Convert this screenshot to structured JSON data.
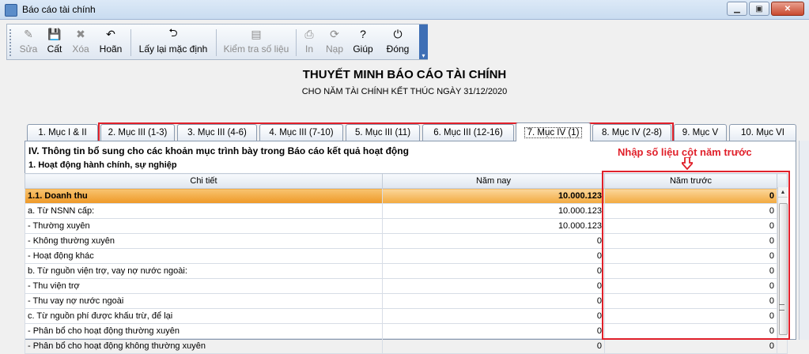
{
  "window": {
    "title": "Báo cáo tài chính",
    "minimize": "▁",
    "maximize": "▣",
    "close": "✕"
  },
  "toolbar": {
    "buttons": [
      {
        "label": "Sửa",
        "icon": "✎",
        "icon_name": "edit-icon",
        "enabled": false
      },
      {
        "label": "Cất",
        "icon": "💾",
        "icon_name": "save-icon",
        "enabled": true
      },
      {
        "label": "Xóa",
        "icon": "✖",
        "icon_name": "delete-icon",
        "enabled": false
      },
      {
        "label": "Hoãn",
        "icon": "↶",
        "icon_name": "undo-icon",
        "enabled": true
      },
      {
        "label": "Lấy lại mặc định",
        "icon": "⮌",
        "icon_name": "restore-default-icon",
        "enabled": true
      },
      {
        "label": "Kiểm tra số liệu",
        "icon": "▤",
        "icon_name": "check-data-icon",
        "enabled": false
      },
      {
        "label": "In",
        "icon": "⎙",
        "icon_name": "print-icon",
        "enabled": false
      },
      {
        "label": "Nạp",
        "icon": "⟳",
        "icon_name": "load-icon",
        "enabled": false
      },
      {
        "label": "Giúp",
        "icon": "?",
        "icon_name": "help-icon",
        "enabled": true
      },
      {
        "label": "Đóng",
        "icon": "⏻",
        "icon_name": "close-form-icon",
        "enabled": true
      }
    ],
    "overflow": "▾"
  },
  "report": {
    "title": "THUYẾT MINH BÁO CÁO TÀI CHÍNH",
    "subtitle": "CHO NĂM TÀI CHÍNH KẾT THÚC NGÀY 31/12/2020"
  },
  "tabs": [
    {
      "label": "1. Mục I & II",
      "active": false
    },
    {
      "label": "2. Mục III (1-3)",
      "active": false
    },
    {
      "label": "3. Mục III (4-6)",
      "active": false
    },
    {
      "label": "4. Mục III (7-10)",
      "active": false
    },
    {
      "label": "5. Mục III (11)",
      "active": false
    },
    {
      "label": "6. Mục III (12-16)",
      "active": false
    },
    {
      "label": "7. Mục IV (1)",
      "active": true
    },
    {
      "label": "8. Mục IV (2-8)",
      "active": false
    },
    {
      "label": "9. Mục V",
      "active": false
    },
    {
      "label": "10. Mục VI",
      "active": false
    }
  ],
  "section": {
    "title": "IV. Thông tin bổ sung cho các khoản mục trình bày trong Báo cáo kết quả hoạt động",
    "subtitle": "1. Hoạt động hành chính, sự nghiệp"
  },
  "annotation": {
    "text": "Nhập số liệu cột năm trước",
    "color": "#e0202a"
  },
  "table": {
    "columns": [
      "Chi tiết",
      "Năm nay",
      "Năm trước"
    ],
    "rows": [
      {
        "label": "1.1. Doanh thu",
        "current": "10.000.123",
        "previous": "0",
        "highlight": true
      },
      {
        "label": "a. Từ NSNN cấp:",
        "current": "10.000.123",
        "previous": "0",
        "highlight": false
      },
      {
        "label": "- Thường xuyên",
        "current": "10.000.123",
        "previous": "0",
        "highlight": false
      },
      {
        "label": "- Không thường xuyên",
        "current": "0",
        "previous": "0",
        "highlight": false
      },
      {
        "label": "- Hoạt động khác",
        "current": "0",
        "previous": "0",
        "highlight": false
      },
      {
        "label": "b. Từ nguồn viện trợ, vay nợ nước ngoài:",
        "current": "0",
        "previous": "0",
        "highlight": false
      },
      {
        "label": "- Thu viện trợ",
        "current": "0",
        "previous": "0",
        "highlight": false
      },
      {
        "label": "- Thu vay nợ nước ngoài",
        "current": "0",
        "previous": "0",
        "highlight": false
      },
      {
        "label": "c. Từ nguồn phí được khấu trừ, để lại",
        "current": "0",
        "previous": "0",
        "highlight": false
      },
      {
        "label": "- Phân bổ cho hoạt động thường xuyên",
        "current": "0",
        "previous": "0",
        "highlight": false
      },
      {
        "label": "- Phân bổ cho hoạt động không thường xuyên",
        "current": "0",
        "previous": "0",
        "highlight": false
      }
    ]
  },
  "colors": {
    "highlight": "#f2a93e",
    "accent": "#3e6fb5",
    "annotation": "#e0202a"
  }
}
